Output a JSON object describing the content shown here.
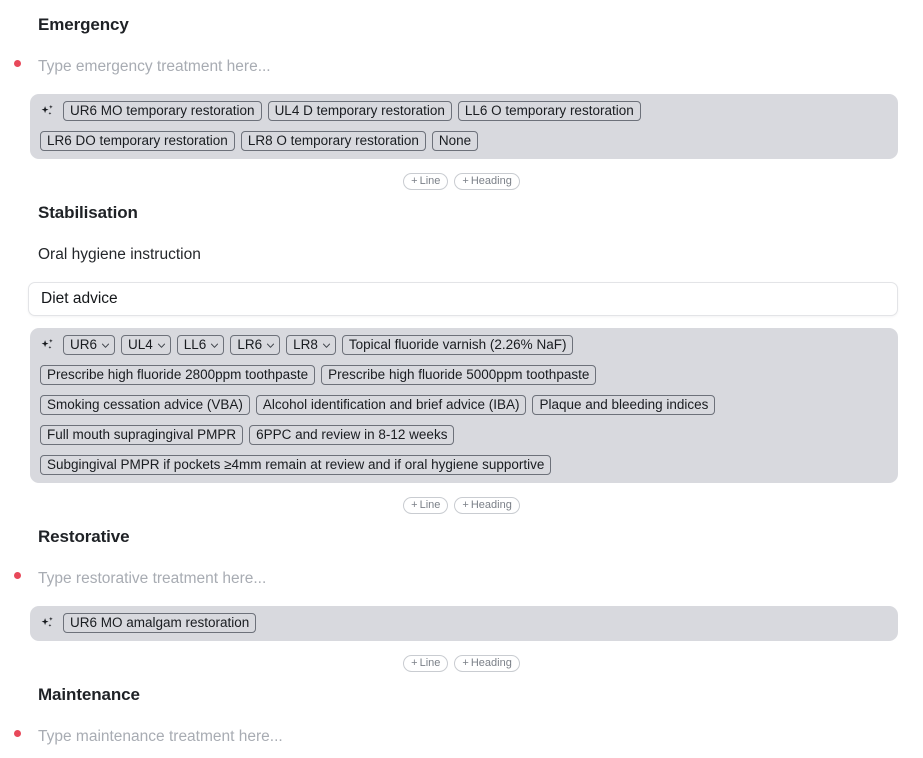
{
  "icons": {
    "sparkle": "sparkle-icon",
    "chevron_down": "chevron-down-icon",
    "bullet": "bullet-dot-icon"
  },
  "colors": {
    "heading_text": "#1f2226",
    "placeholder_text": "#a8acb3",
    "bullet_red": "#e8485a",
    "panel_bg": "#d8d9de",
    "chip_border": "#6d717a",
    "input_border": "#e3e4e7",
    "page_bg": "#ffffff"
  },
  "add_controls": {
    "line_label": "Line",
    "heading_label": "Heading",
    "plus": "+"
  },
  "sections": [
    {
      "id": "emergency",
      "heading": "Emergency",
      "placeholder": "Type emergency treatment here...",
      "suggestions": [
        {
          "label": "UR6 MO temporary restoration",
          "type": "chip"
        },
        {
          "label": "UL4 D temporary restoration",
          "type": "chip"
        },
        {
          "label": "LL6 O temporary restoration",
          "type": "chip"
        },
        {
          "label": "LR6 DO temporary restoration",
          "type": "chip",
          "break_before": true
        },
        {
          "label": "LR8 O temporary restoration",
          "type": "chip"
        },
        {
          "label": "None",
          "type": "chip"
        }
      ]
    },
    {
      "id": "stabilisation",
      "heading": "Stabilisation",
      "text_line": "Oral hygiene instruction",
      "input_value": "Diet advice",
      "suggestions": [
        {
          "label": "UR6",
          "type": "dropdown"
        },
        {
          "label": "UL4",
          "type": "dropdown"
        },
        {
          "label": "LL6",
          "type": "dropdown"
        },
        {
          "label": "LR6",
          "type": "dropdown"
        },
        {
          "label": "LR8",
          "type": "dropdown"
        },
        {
          "label": "Topical fluoride varnish (2.26% NaF)",
          "type": "chip"
        },
        {
          "label": "Prescribe high fluoride 2800ppm toothpaste",
          "type": "chip",
          "break_before": true
        },
        {
          "label": "Prescribe high fluoride 5000ppm toothpaste",
          "type": "chip"
        },
        {
          "label": "Smoking cessation advice (VBA)",
          "type": "chip",
          "break_before": true
        },
        {
          "label": "Alcohol identification and brief advice (IBA)",
          "type": "chip"
        },
        {
          "label": "Plaque and bleeding indices",
          "type": "chip"
        },
        {
          "label": "Full mouth supragingival PMPR",
          "type": "chip",
          "break_before": true
        },
        {
          "label": "6PPC and review in 8-12 weeks",
          "type": "chip"
        },
        {
          "label": "Subgingival PMPR if pockets ≥4mm remain at review and if oral hygiene supportive",
          "type": "chip",
          "break_before": true
        }
      ]
    },
    {
      "id": "restorative",
      "heading": "Restorative",
      "placeholder": "Type restorative treatment here...",
      "suggestions": [
        {
          "label": "UR6 MO amalgam restoration",
          "type": "chip"
        }
      ]
    },
    {
      "id": "maintenance",
      "heading": "Maintenance",
      "placeholder": "Type maintenance treatment here..."
    }
  ]
}
